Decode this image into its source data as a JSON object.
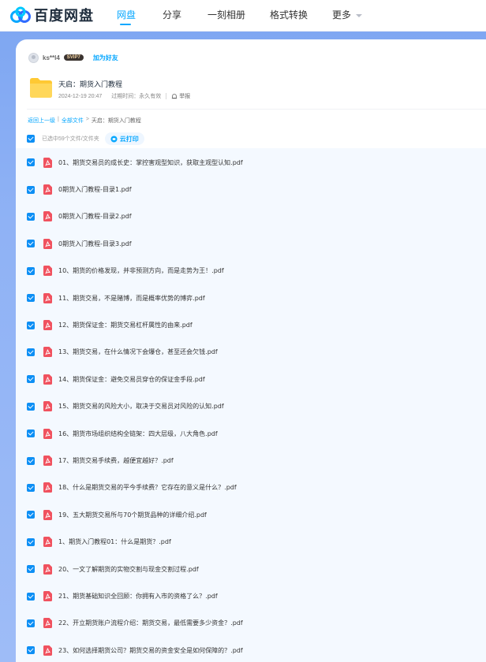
{
  "brand": {
    "name": "百度网盘"
  },
  "nav": {
    "items": [
      {
        "label": "网盘"
      },
      {
        "label": "分享"
      },
      {
        "label": "一刻相册"
      },
      {
        "label": "格式转换"
      },
      {
        "label": "更多"
      }
    ]
  },
  "sharer": {
    "username": "ks**l4",
    "vip_badge": "SVIP7",
    "add_friend": "加为好友"
  },
  "share": {
    "title": "天启：期货入门教程",
    "date": "2024-12-19 20:47",
    "expiry": "过期时间：永久有效",
    "report": "举报"
  },
  "breadcrumb": {
    "back": "返回上一级",
    "all_files": "全部文件",
    "current": "天启：期货入门教程"
  },
  "selection": {
    "count_text": "已选中59个文件/文件夹",
    "print_label": "云打印"
  },
  "files": [
    {
      "name": "01、期货交易员的成长史：掌控害观型知识，获取主观型认知.pdf"
    },
    {
      "name": "0期货入门教程-目录1.pdf"
    },
    {
      "name": "0期货入门教程-目录2.pdf"
    },
    {
      "name": "0期货入门教程-目录3.pdf"
    },
    {
      "name": "10、期货的价格发现，并非预测方向，而是走势为王！.pdf"
    },
    {
      "name": "11、期货交易，不是赌博，而是概率优势的博弈.pdf"
    },
    {
      "name": "12、期货保证金：期货交易杠杆属性的由来.pdf"
    },
    {
      "name": "13、期货交易，在什么情况下会爆仓，甚至还会欠钱.pdf"
    },
    {
      "name": "14、期货保证金：避免交易员穿仓的保证金手段.pdf"
    },
    {
      "name": "15、期货交易的风险大小，取决于交易员对风险的认知.pdf"
    },
    {
      "name": "16、期货市场组织结构全链架：四大层级，八大角色.pdf"
    },
    {
      "name": "17、期货交易手续费，越便宜越好？.pdf"
    },
    {
      "name": "18、什么是期货交易的平今手续费？它存在的意义是什么？.pdf"
    },
    {
      "name": "19、五大期货交易所与70个期货品种的详细介绍.pdf"
    },
    {
      "name": "1、期货入门教程01：什么是期货？.pdf"
    },
    {
      "name": "20、一文了解期货的实物交割与现金交割过程.pdf"
    },
    {
      "name": "21、期货基础知识全回顾：你拥有入市的资格了么？.pdf"
    },
    {
      "name": "22、开立期货账户流程介绍：期货交易，最低需要多少资金？.pdf"
    },
    {
      "name": "23、如何选择期货公司？期货交易的资金安全是如何保障的？.pdf"
    }
  ]
}
